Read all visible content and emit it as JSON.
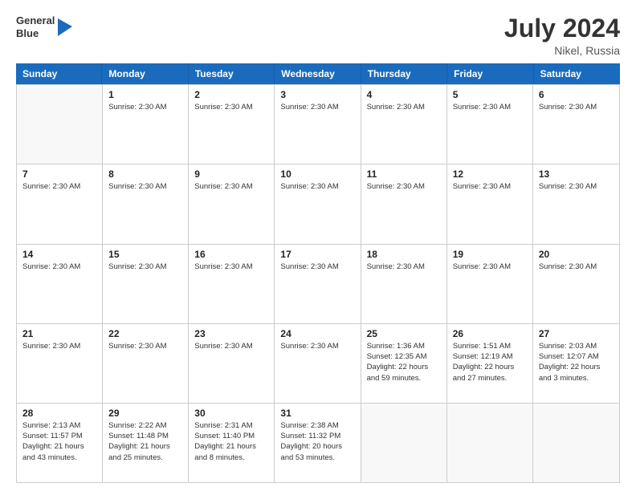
{
  "logo": {
    "line1": "General",
    "line2": "Blue"
  },
  "title": "July 2024",
  "location": "Nikel, Russia",
  "weekdays": [
    "Sunday",
    "Monday",
    "Tuesday",
    "Wednesday",
    "Thursday",
    "Friday",
    "Saturday"
  ],
  "weeks": [
    [
      {
        "day": "",
        "info": ""
      },
      {
        "day": "1",
        "info": "Sunrise: 2:30 AM"
      },
      {
        "day": "2",
        "info": "Sunrise: 2:30 AM"
      },
      {
        "day": "3",
        "info": "Sunrise: 2:30 AM"
      },
      {
        "day": "4",
        "info": "Sunrise: 2:30 AM"
      },
      {
        "day": "5",
        "info": "Sunrise: 2:30 AM"
      },
      {
        "day": "6",
        "info": "Sunrise: 2:30 AM"
      }
    ],
    [
      {
        "day": "7",
        "info": "Sunrise: 2:30 AM"
      },
      {
        "day": "8",
        "info": "Sunrise: 2:30 AM"
      },
      {
        "day": "9",
        "info": "Sunrise: 2:30 AM"
      },
      {
        "day": "10",
        "info": "Sunrise: 2:30 AM"
      },
      {
        "day": "11",
        "info": "Sunrise: 2:30 AM"
      },
      {
        "day": "12",
        "info": "Sunrise: 2:30 AM"
      },
      {
        "day": "13",
        "info": "Sunrise: 2:30 AM"
      }
    ],
    [
      {
        "day": "14",
        "info": "Sunrise: 2:30 AM"
      },
      {
        "day": "15",
        "info": "Sunrise: 2:30 AM"
      },
      {
        "day": "16",
        "info": "Sunrise: 2:30 AM"
      },
      {
        "day": "17",
        "info": "Sunrise: 2:30 AM"
      },
      {
        "day": "18",
        "info": "Sunrise: 2:30 AM"
      },
      {
        "day": "19",
        "info": "Sunrise: 2:30 AM"
      },
      {
        "day": "20",
        "info": "Sunrise: 2:30 AM"
      }
    ],
    [
      {
        "day": "21",
        "info": "Sunrise: 2:30 AM"
      },
      {
        "day": "22",
        "info": "Sunrise: 2:30 AM"
      },
      {
        "day": "23",
        "info": "Sunrise: 2:30 AM"
      },
      {
        "day": "24",
        "info": "Sunrise: 2:30 AM"
      },
      {
        "day": "25",
        "info": "Sunrise: 1:36 AM\nSunset: 12:35 AM\nDaylight: 22 hours and 59 minutes."
      },
      {
        "day": "26",
        "info": "Sunrise: 1:51 AM\nSunset: 12:19 AM\nDaylight: 22 hours and 27 minutes."
      },
      {
        "day": "27",
        "info": "Sunrise: 2:03 AM\nSunset: 12:07 AM\nDaylight: 22 hours and 3 minutes."
      }
    ],
    [
      {
        "day": "28",
        "info": "Sunrise: 2:13 AM\nSunset: 11:57 PM\nDaylight: 21 hours and 43 minutes."
      },
      {
        "day": "29",
        "info": "Sunrise: 2:22 AM\nSunset: 11:48 PM\nDaylight: 21 hours and 25 minutes."
      },
      {
        "day": "30",
        "info": "Sunrise: 2:31 AM\nSunset: 11:40 PM\nDaylight: 21 hours and 8 minutes."
      },
      {
        "day": "31",
        "info": "Sunrise: 2:38 AM\nSunset: 11:32 PM\nDaylight: 20 hours and 53 minutes."
      },
      {
        "day": "",
        "info": ""
      },
      {
        "day": "",
        "info": ""
      },
      {
        "day": "",
        "info": ""
      }
    ]
  ]
}
